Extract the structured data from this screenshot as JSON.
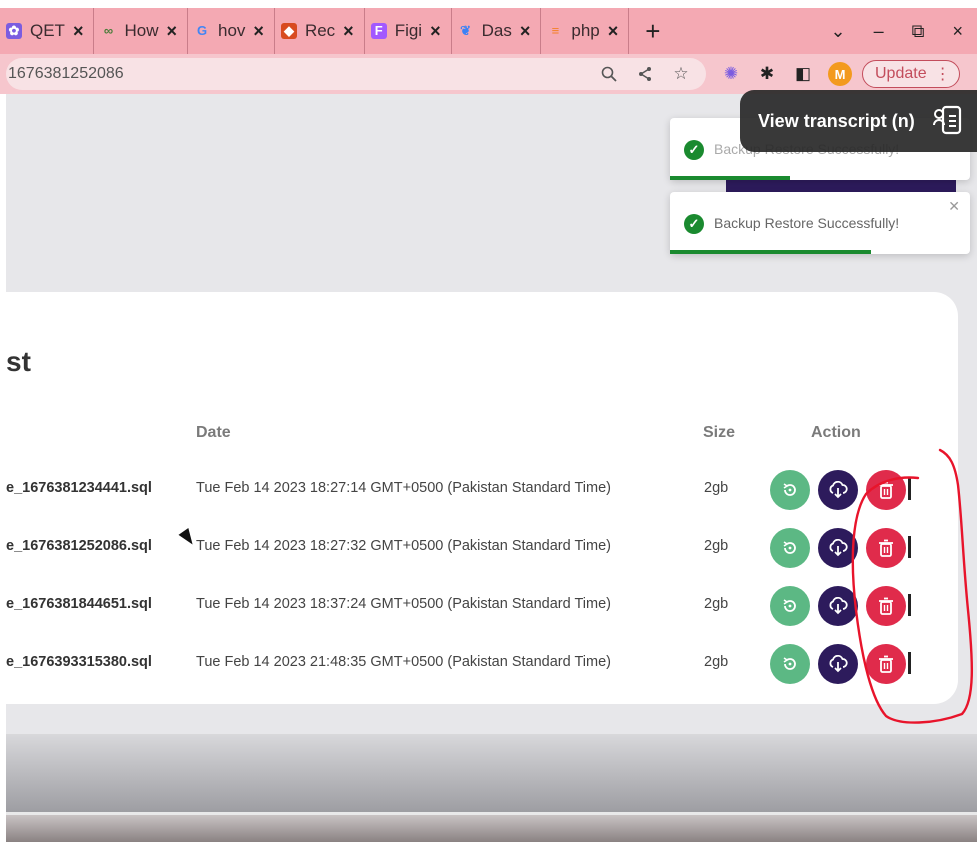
{
  "browser": {
    "tabs": [
      {
        "label": "QET",
        "favicon": "qet-icon",
        "color": "#7b5ce0"
      },
      {
        "label": "How",
        "favicon": "link-icon",
        "color": "#4a7c3a"
      },
      {
        "label": "hov",
        "favicon": "google-icon",
        "color": "#4285f4"
      },
      {
        "label": "Rec",
        "favicon": "gem-icon",
        "color": "#d84b20"
      },
      {
        "label": "Figi",
        "favicon": "figma-icon",
        "color": "#a259ff"
      },
      {
        "label": "Das",
        "favicon": "bird-icon",
        "color": "#3b82f6"
      },
      {
        "label": "php",
        "favicon": "stack-icon",
        "color": "#f48024"
      }
    ],
    "url": "1676381252086",
    "update_label": "Update",
    "avatar_letter": "M"
  },
  "transcript": {
    "label": "View transcript (n)"
  },
  "toasts": [
    {
      "message": "Backup Restore Successfully!",
      "progress": 0.4
    },
    {
      "message": "Backup Restore Successfully!",
      "progress": 0.67
    }
  ],
  "card": {
    "title": "st",
    "columns": {
      "date": "Date",
      "size": "Size",
      "action": "Action"
    },
    "rows": [
      {
        "name": "e_1676381234441.sql",
        "date": "Tue Feb 14 2023 18:27:14 GMT+0500 (Pakistan Standard Time)",
        "size": "2gb"
      },
      {
        "name": "e_1676381252086.sql",
        "date": "Tue Feb 14 2023 18:27:32 GMT+0500 (Pakistan Standard Time)",
        "size": "2gb"
      },
      {
        "name": "e_1676381844651.sql",
        "date": "Tue Feb 14 2023 18:37:24 GMT+0500 (Pakistan Standard Time)",
        "size": "2gb"
      },
      {
        "name": "e_1676393315380.sql",
        "date": "Tue Feb 14 2023 21:48:35 GMT+0500 (Pakistan Standard Time)",
        "size": "2gb"
      }
    ]
  },
  "colors": {
    "restore": "#5cb884",
    "download": "#2d1b5c",
    "delete": "#e02b4b",
    "annotation": "#e8142b"
  }
}
